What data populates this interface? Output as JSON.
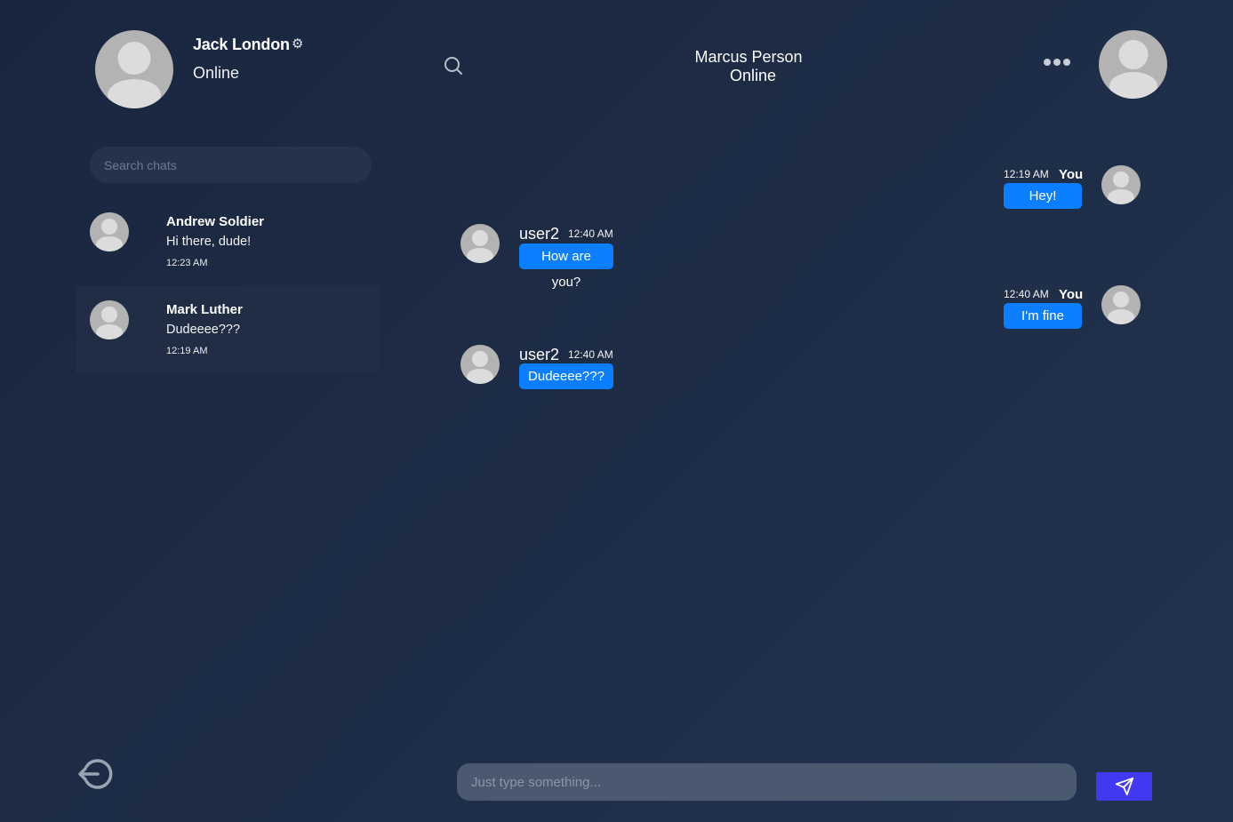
{
  "current_user": {
    "name": "Jack London",
    "status": "Online",
    "settings_icon": "gear-icon"
  },
  "sidebar": {
    "search_placeholder": "Search chats",
    "chats": [
      {
        "name": "Andrew Soldier",
        "preview": "Hi there, dude!",
        "time": "12:23 AM",
        "active": false
      },
      {
        "name": "Mark Luther",
        "preview": "Dudeeee???",
        "time": "12:19 AM",
        "active": true
      }
    ],
    "logout_icon": "logout-icon"
  },
  "conversation": {
    "peer_name": "Marcus Person",
    "peer_status": "Online",
    "search_icon": "search-icon",
    "more_icon": "more-horizontal-icon",
    "messages": [
      {
        "author": "You",
        "time": "12:19 AM",
        "text": "Hey!",
        "mine": true
      },
      {
        "author": "user2",
        "time": "12:40 AM",
        "text": "How are you?",
        "mine": false
      },
      {
        "author": "You",
        "time": "12:40 AM",
        "text": "I'm fine",
        "mine": true
      },
      {
        "author": "user2",
        "time": "12:40 AM",
        "text": "Dudeeee???",
        "mine": false
      }
    ],
    "compose_placeholder": "Just type something...",
    "send_icon": "send-icon"
  },
  "colors": {
    "background": "#1d2a43",
    "bubble": "#0b7fff",
    "send_button": "#4339f2",
    "active_chat": "#202d45",
    "avatar": "#b3b3b3"
  }
}
